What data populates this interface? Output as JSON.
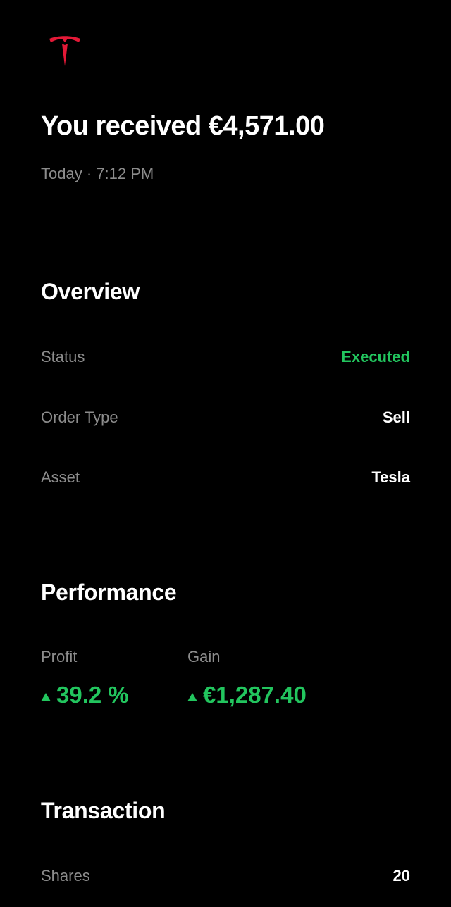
{
  "brand": {
    "logo_icon": "tesla-logo-icon",
    "logo_color": "#e31937"
  },
  "header": {
    "headline": "You received €4,571.00",
    "timestamp": "Today · 7:12 PM"
  },
  "overview": {
    "title": "Overview",
    "rows": [
      {
        "label": "Status",
        "value": "Executed"
      },
      {
        "label": "Order Type",
        "value": "Sell"
      },
      {
        "label": "Asset",
        "value": "Tesla"
      }
    ]
  },
  "performance": {
    "title": "Performance",
    "metrics": [
      {
        "label": "Profit",
        "value": "39.2 %",
        "trend_icon": "triangle-up-icon"
      },
      {
        "label": "Gain",
        "value": "€1,287.40",
        "trend_icon": "triangle-up-icon"
      }
    ]
  },
  "transaction": {
    "title": "Transaction",
    "rows": [
      {
        "label": "Shares",
        "value": "20"
      }
    ]
  },
  "colors": {
    "background": "#000000",
    "positive": "#22c55e",
    "muted_text": "#8c8c8c",
    "text": "#ffffff"
  }
}
